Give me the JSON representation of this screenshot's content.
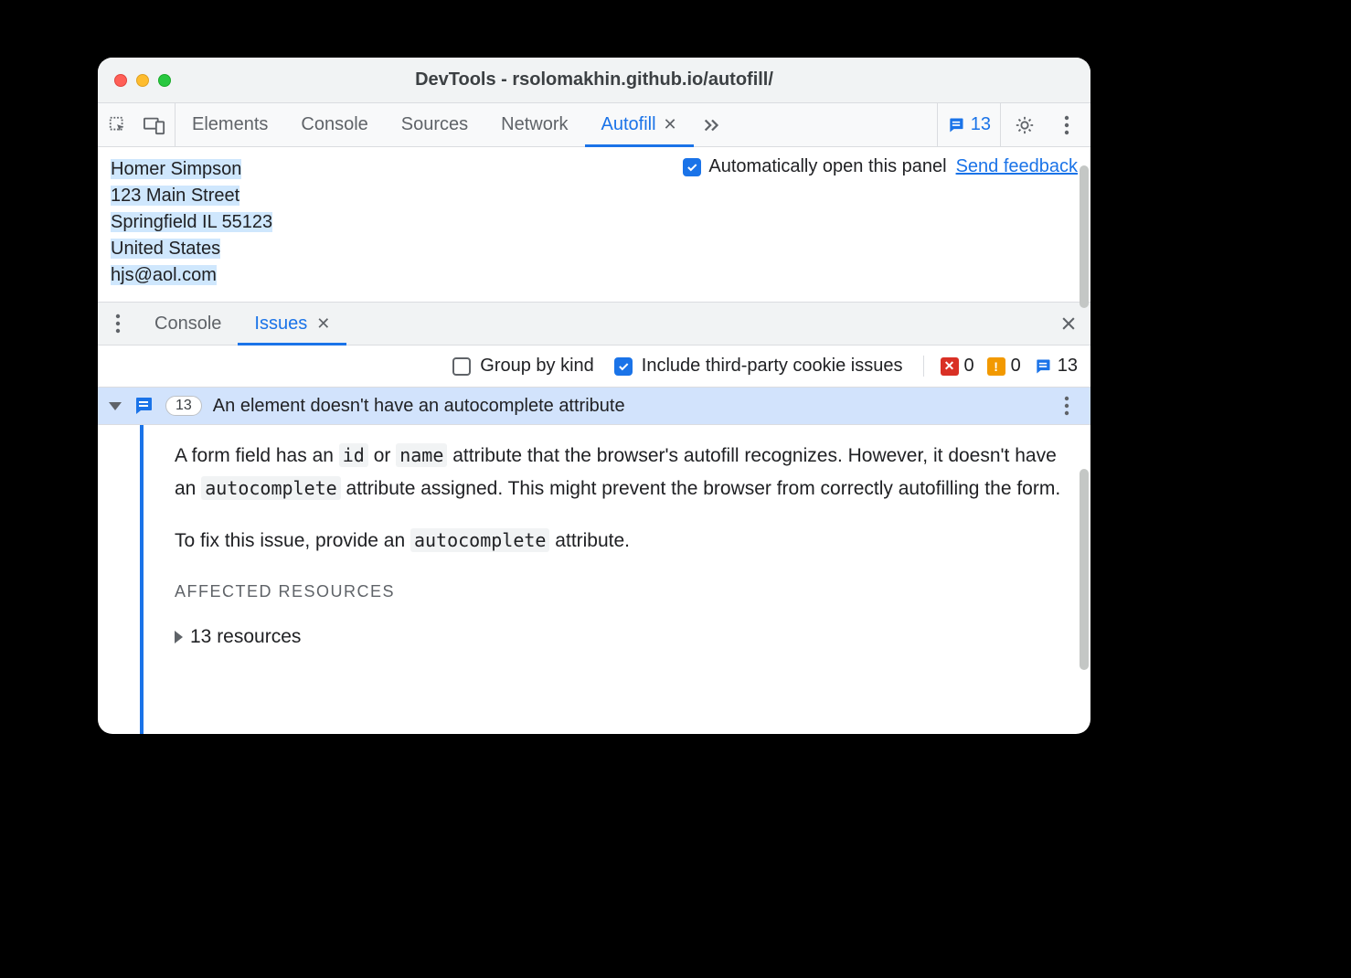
{
  "window": {
    "title": "DevTools - rsolomakhin.github.io/autofill/"
  },
  "toolbar": {
    "inspect_icon": "inspect-element",
    "device_icon": "device-toolbar",
    "tabs": [
      "Elements",
      "Console",
      "Sources",
      "Network",
      "Autofill"
    ],
    "active_tab": "Autofill",
    "issue_badge_count": "13",
    "more_tabs_icon": "chevron-double-right",
    "settings_icon": "gear",
    "overflow_icon": "dots-vertical"
  },
  "autofill_panel": {
    "lines": {
      "name": "Homer Simpson",
      "street": "123 Main Street",
      "city_state_zip_1": "Springfield IL ",
      "city_state_zip_2": "55123",
      "country": "United States",
      "email": "hjs@aol.com"
    },
    "auto_open_label": "Automatically open this panel",
    "feedback_label": "Send feedback"
  },
  "drawer": {
    "tabs": [
      "Console",
      "Issues"
    ],
    "active": "Issues"
  },
  "issues_toolbar": {
    "group_by_kind": "Group by kind",
    "include_third_party": "Include third-party cookie issues",
    "counts": {
      "errors": "0",
      "warnings": "0",
      "info": "13"
    }
  },
  "issue": {
    "count": "13",
    "title": "An element doesn't have an autocomplete attribute",
    "p1_a": "A form field has an ",
    "p1_code1": "id",
    "p1_b": " or ",
    "p1_code2": "name",
    "p1_c": " attribute that the browser's autofill recognizes. However, it doesn't have an ",
    "p1_code3": "autocomplete",
    "p1_d": " attribute assigned. This might prevent the browser from correctly autofilling the form.",
    "p2_a": "To fix this issue, provide an ",
    "p2_code1": "autocomplete",
    "p2_b": " attribute.",
    "affected_label": "AFFECTED RESOURCES",
    "resources_text": "13 resources"
  }
}
